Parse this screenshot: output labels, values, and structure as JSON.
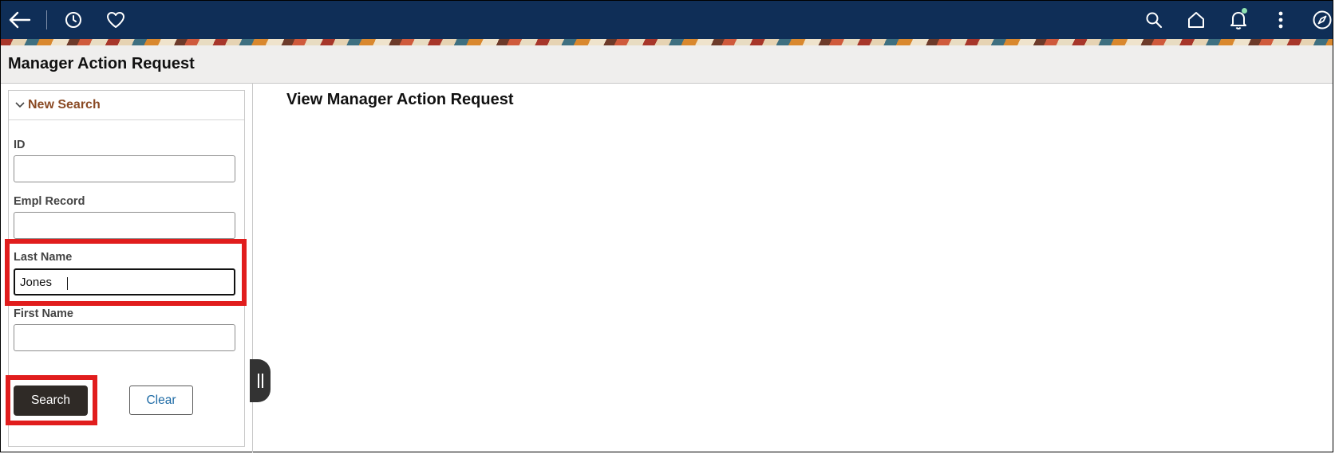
{
  "header": {
    "icons": [
      "back-arrow-icon",
      "history-icon",
      "favorites-heart-icon",
      "search-icon",
      "home-icon",
      "notifications-bell-icon",
      "more-actions-icon",
      "navigator-compass-icon"
    ],
    "colors": {
      "bar": "#0f2e57",
      "icon": "#ffffff",
      "notification_dot": "#8ee0b0"
    }
  },
  "page": {
    "title": "Manager Action Request"
  },
  "search_panel": {
    "header_label": "New Search",
    "fields": {
      "id": {
        "label": "ID",
        "value": ""
      },
      "empl_record": {
        "label": "Empl Record",
        "value": ""
      },
      "last_name": {
        "label": "Last Name",
        "value": "Jones"
      },
      "first_name": {
        "label": "First Name",
        "value": ""
      }
    },
    "search_button": "Search",
    "clear_button": "Clear"
  },
  "main": {
    "title": "View Manager Action Request"
  },
  "colors": {
    "highlight": "#e11d1d",
    "section_header": "#8a4a24",
    "link": "#1d6aa5",
    "primary_button": "#2f2a26"
  }
}
